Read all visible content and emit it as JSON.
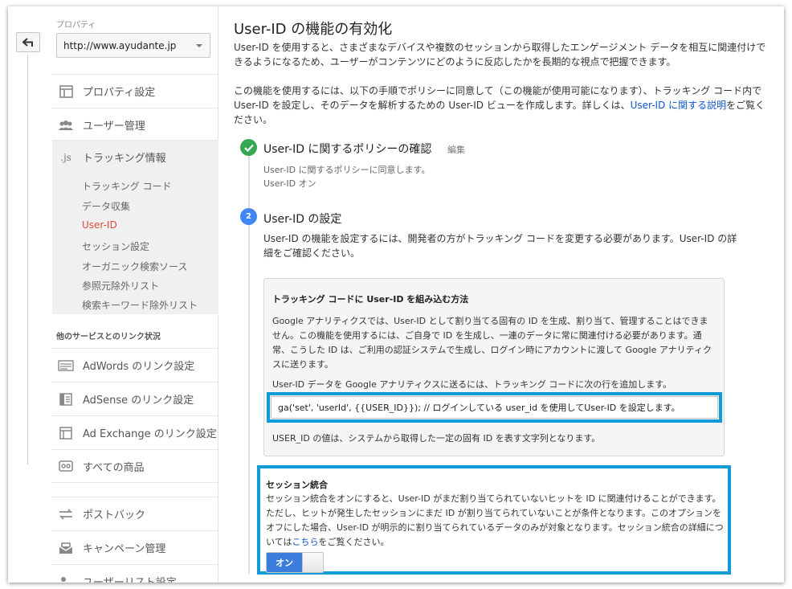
{
  "sidebar": {
    "property_label": "プロパティ",
    "property_value": "http://www.ayudante.jp",
    "items": [
      {
        "label": "プロパティ設定",
        "icon": "window-icon"
      },
      {
        "label": "ユーザー管理",
        "icon": "users-icon"
      },
      {
        "label": "トラッキング情報",
        "icon": "js-icon"
      }
    ],
    "js_icon_text": ".js",
    "tracking_subitems": [
      "トラッキング コード",
      "データ収集",
      "User-ID",
      "セッション設定",
      "オーガニック検索ソース",
      "参照元除外リスト",
      "検索キーワード除外リスト"
    ],
    "links_section_label": "他のサービスとのリンク状況",
    "link_items": [
      {
        "label": "AdWords のリンク設定",
        "icon": "adwords-icon"
      },
      {
        "label": "AdSense のリンク設定",
        "icon": "adsense-icon"
      },
      {
        "label": "Ad Exchange のリンク設定",
        "icon": "adexchange-icon"
      },
      {
        "label": "すべての商品",
        "icon": "all-products-icon"
      },
      {
        "label": "ポストバック",
        "icon": "postback-icon"
      },
      {
        "label": "キャンペーン管理",
        "icon": "campaign-icon"
      },
      {
        "label": "ユーザーリスト設定",
        "icon": "userlist-icon"
      }
    ]
  },
  "main": {
    "title": "User-ID の機能の有効化",
    "intro": "User-ID を使用すると、さまざまなデバイスや複数のセッションから取得したエンゲージメント データを相互に関連付けできるようになるため、ユーザーがコンテンツにどのように反応したかを長期的な視点で把握できます。",
    "how_to_before": "この機能を使用するには、以下の手順でポリシーに同意して（この機能が使用可能になります）、トラッキング コード内で User-ID を設定し、そのデータを解析するための User-ID ビューを作成します。詳しくは、",
    "how_to_link": "User-ID に関する説明",
    "how_to_after": "をご覧ください。",
    "step1": {
      "title": "User-ID に関するポリシーの確認",
      "edit": "編集",
      "line1": "User-ID に関するポリシーに同意します。",
      "line2": "User-ID オン"
    },
    "step2": {
      "number": "2",
      "title": "User-ID の設定",
      "desc": "User-ID の機能を設定するには、開発者の方がトラッキング コードを変更する必要があります。User-ID の詳細をご確認ください。"
    },
    "card": {
      "title": "トラッキング コードに User-ID を組み込む方法",
      "text1": "Google アナリティクスでは、User-ID として割り当てる固有の ID を生成、割り当て、管理することはできません。この機能を使用するには、ご自身で ID を生成し、一連のデータに常に関連付ける必要があります。通常、こうした ID は、ご利用の認証システムで生成し、ログイン時にアカウントに渡して Google アナリティクスに送ります。",
      "text2": "User-ID データを Google アナリティクスに送るには、トラッキング コードに次の行を追加します。",
      "code": "ga('set', 'userId', {{USER_ID}}); // ログインしている user_id を使用してUser-ID を設定します。",
      "text3": "USER_ID の値は、システムから取得した一定の固有 ID を表す文字列となります。"
    },
    "session": {
      "title": "セッション統合",
      "text_before": "セッション統合をオンにすると、User-ID がまだ割り当てられていないヒットを ID に関連付けることができます。ただし、ヒットが発生したセッションにまだ ID が割り当てられていないことが条件となります。このオプションをオフにした場合、User-ID が明示的に割り当てられているデータのみが対象となります。セッション統合の詳細については",
      "link": "こちら",
      "text_after": "をご覧ください。",
      "toggle_label": "オン"
    }
  },
  "colors": {
    "highlight": "#0e9bd8",
    "current_nav": "#dd4b39",
    "link": "#1155cc",
    "check": "#34a853",
    "step": "#4285f4",
    "toggle_on": "#3b7ddd"
  }
}
